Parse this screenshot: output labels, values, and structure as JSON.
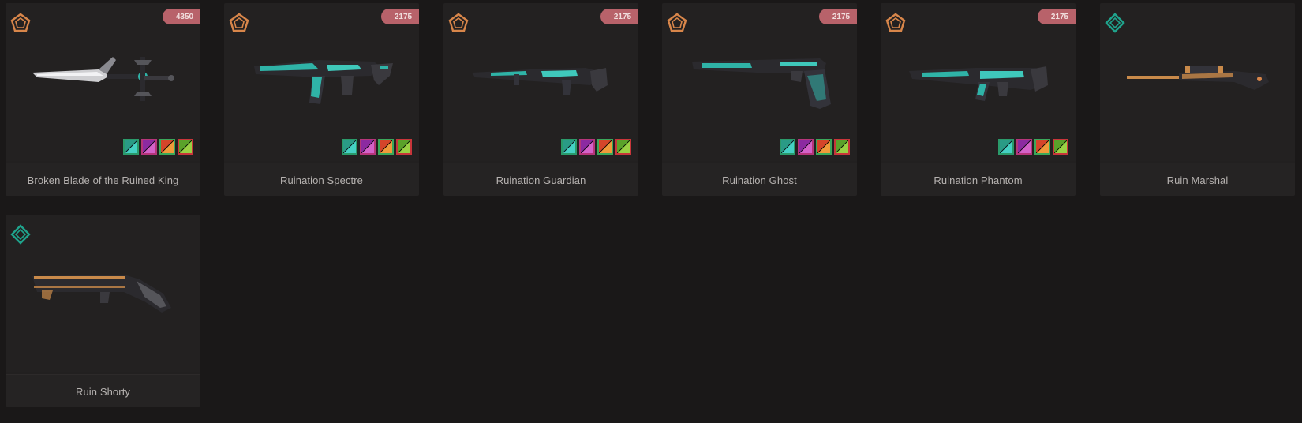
{
  "cards": [
    {
      "name": "Broken Blade of the Ruined King",
      "price": "4350",
      "tier": "pentagon-tier-icon",
      "tier_color": "#d8864a",
      "weapon_icon": "knife-icon",
      "swatches": [
        "teal",
        "purple",
        "orange",
        "green"
      ]
    },
    {
      "name": "Ruination Spectre",
      "price": "2175",
      "tier": "pentagon-tier-icon",
      "tier_color": "#d8864a",
      "weapon_icon": "smg-icon",
      "swatches": [
        "teal",
        "purple",
        "orange",
        "green"
      ]
    },
    {
      "name": "Ruination Guardian",
      "price": "2175",
      "tier": "pentagon-tier-icon",
      "tier_color": "#d8864a",
      "weapon_icon": "rifle-icon",
      "swatches": [
        "teal",
        "purple",
        "orange",
        "green"
      ]
    },
    {
      "name": "Ruination Ghost",
      "price": "2175",
      "tier": "pentagon-tier-icon",
      "tier_color": "#d8864a",
      "weapon_icon": "pistol-icon",
      "swatches": [
        "teal",
        "purple",
        "orange",
        "green"
      ]
    },
    {
      "name": "Ruination Phantom",
      "price": "2175",
      "tier": "pentagon-tier-icon",
      "tier_color": "#d8864a",
      "weapon_icon": "rifle-icon",
      "swatches": [
        "teal",
        "purple",
        "orange",
        "green"
      ]
    },
    {
      "name": "Ruin Marshal",
      "price": "",
      "tier": "diamond-tier-icon",
      "tier_color": "#1fa38c",
      "weapon_icon": "sniper-icon",
      "swatches": []
    },
    {
      "name": "Ruin Shorty",
      "price": "",
      "tier": "diamond-tier-icon",
      "tier_color": "#1fa38c",
      "weapon_icon": "shotgun-icon",
      "swatches": []
    }
  ],
  "colors": {
    "background": "#1a1818",
    "card": "#222020",
    "price_badge": "#b8626a",
    "ruination_teal": "#2fb3a7",
    "ruin_gold": "#c98a4a"
  }
}
